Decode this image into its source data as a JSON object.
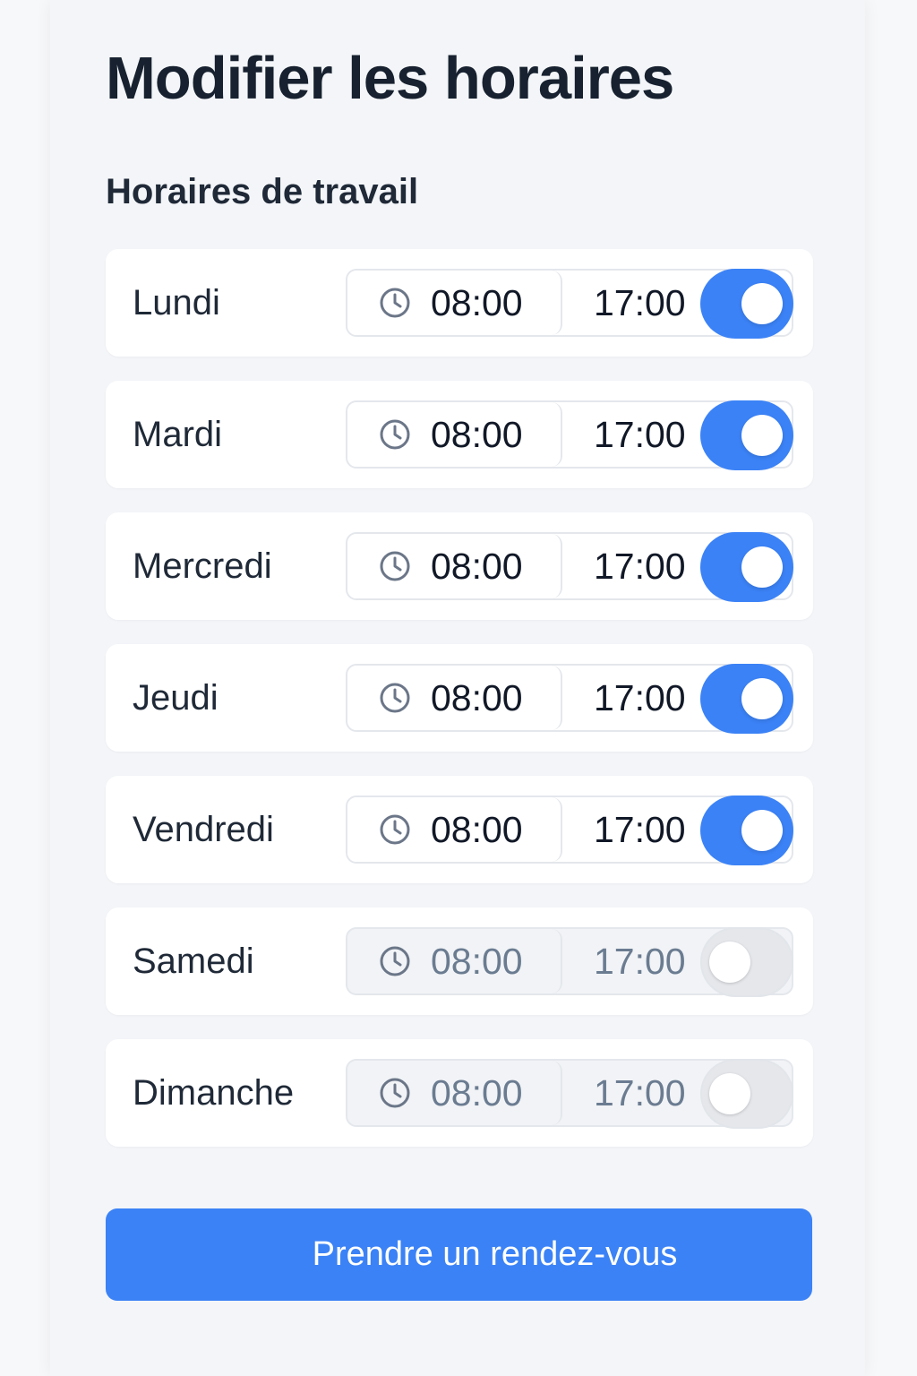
{
  "header": {
    "title": "Modifier les horaires"
  },
  "section": {
    "title": "Horaires de travail"
  },
  "days": [
    {
      "label": "Lundi",
      "start": "08:00",
      "end": "17:00",
      "enabled": true
    },
    {
      "label": "Mardi",
      "start": "08:00",
      "end": "17:00",
      "enabled": true
    },
    {
      "label": "Mercredi",
      "start": "08:00",
      "end": "17:00",
      "enabled": true
    },
    {
      "label": "Jeudi",
      "start": "08:00",
      "end": "17:00",
      "enabled": true
    },
    {
      "label": "Vendredi",
      "start": "08:00",
      "end": "17:00",
      "enabled": true
    },
    {
      "label": "Samedi",
      "start": "08:00",
      "end": "17:00",
      "enabled": false
    },
    {
      "label": "Dimanche",
      "start": "08:00",
      "end": "17:00",
      "enabled": false
    }
  ],
  "icons": {
    "time": "clock-icon"
  },
  "footer": {
    "button_label": "Prendre un rendez-vous"
  },
  "colors": {
    "accent": "#3b82f6",
    "title": "#17212f",
    "toggle_off": "#e5e7eb",
    "background": "#f3f5f8"
  }
}
